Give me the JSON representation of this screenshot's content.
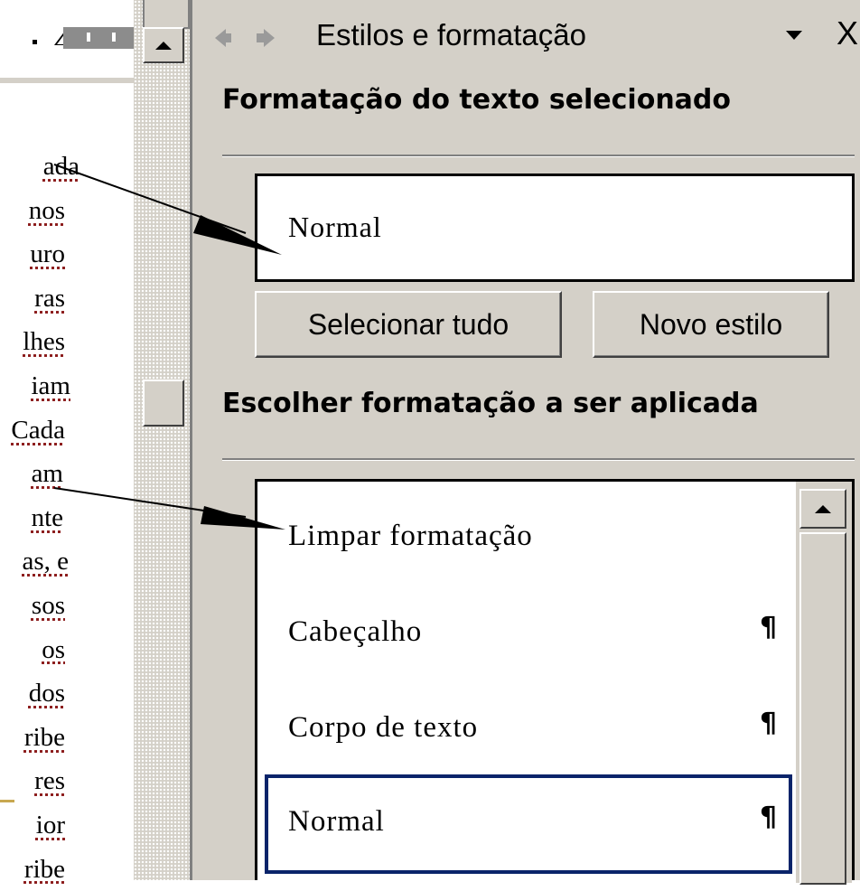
{
  "document": {
    "text_fragments": [
      "ada",
      "nos",
      "uro",
      "ras",
      "lhes",
      "iam",
      "Cada",
      "am",
      "nte",
      "as, e",
      "sos",
      "os",
      "dos",
      "ribe",
      "res",
      "ior",
      "ribe"
    ]
  },
  "task_pane": {
    "title": "Estilos e formatação",
    "nav_back_icon": "back-arrow-icon",
    "nav_forward_icon": "forward-arrow-icon",
    "dropdown_icon": "chevron-down-icon",
    "close_label": "X",
    "selected_text_section": {
      "heading": "Formatação do texto selecionado",
      "current_style": "Normal"
    },
    "buttons": {
      "select_all": "Selecionar tudo",
      "new_style": "Novo estilo"
    },
    "apply_section": {
      "heading": "Escolher formatação a ser aplicada",
      "items": [
        {
          "label": "Limpar formatação",
          "mark": ""
        },
        {
          "label": "Cabeçalho",
          "mark": "¶"
        },
        {
          "label": "Corpo de texto",
          "mark": "¶"
        },
        {
          "label": "Normal",
          "mark": "¶",
          "selected": true
        }
      ]
    }
  },
  "colors": {
    "pane_bg": "#d4d0c8",
    "selection_border": "#0a246a",
    "spelling_underline": "#8b1a1a"
  }
}
